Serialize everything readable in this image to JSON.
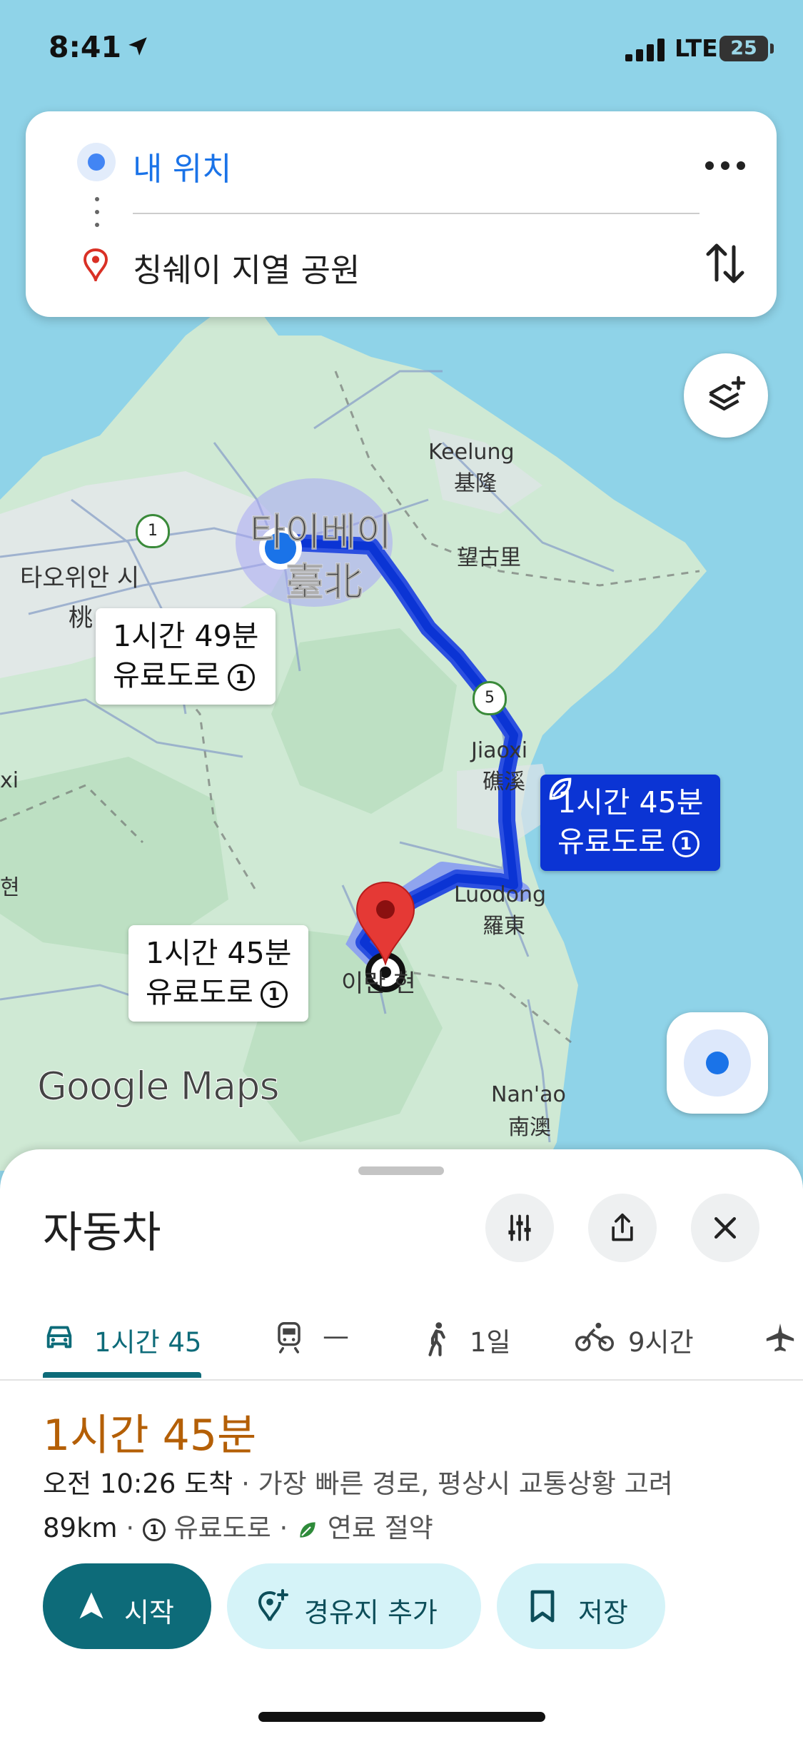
{
  "status_bar": {
    "time": "8:41",
    "network": "LTE",
    "battery": "25"
  },
  "route_search": {
    "origin": "내 위치",
    "destination": "칭쉐이 지열 공원"
  },
  "map": {
    "labels": {
      "taipei_kr": "타이베이",
      "taipei_zh": "臺北",
      "taoyuan_kr": "타오위안 시",
      "taoyuan_zh": "桃",
      "keelung_en": "Keelung",
      "keelung_zh": "基隆",
      "wanggu": "望古里",
      "jiaoxi_en": "Jiaoxi",
      "jiaoxi_zh": "礁溪",
      "luodong_en": "Luodong",
      "luodong_zh": "羅東",
      "yilan_kr": "이란 현",
      "nanao_en": "Nan'ao",
      "nanao_zh": "南澳",
      "edge_left": "xi",
      "edge_left2": "현"
    },
    "shields": {
      "hwy1": "1",
      "hwy5": "5"
    },
    "callouts": {
      "alt1": {
        "time": "1시간 49분",
        "toll": "유료도로"
      },
      "selected": {
        "time": "1시간 45분",
        "toll": "유료도로"
      },
      "alt2": {
        "time": "1시간 45분",
        "toll": "유료도로"
      }
    },
    "watermark": "Google Maps",
    "colors": {
      "route": "#0b34d4",
      "route_alt": "#8fa4ee",
      "water": "#8fd3e8",
      "land": "#cfe9d4"
    }
  },
  "sheet": {
    "mode_title": "자동차",
    "tabs": [
      {
        "label": "1시간 45",
        "icon": "car-icon"
      },
      {
        "label": "—",
        "icon": "train-icon"
      },
      {
        "label": "1일",
        "icon": "walk-icon"
      },
      {
        "label": "9시간",
        "icon": "bike-icon"
      }
    ],
    "duration": "1시간 45분",
    "arrival": "오전 10:26 도착",
    "arrival_note": " · 가장 빠른 경로, 평상시 교통상황 고려",
    "distance": "89km",
    "sep": " · ",
    "toll": "유료도로",
    "fuel": "연료 절약",
    "buttons": {
      "start": "시작",
      "add_waypoint": "경유지 추가",
      "save": "저장"
    },
    "accent": "#0d6b79",
    "duration_color": "#b45f06"
  }
}
